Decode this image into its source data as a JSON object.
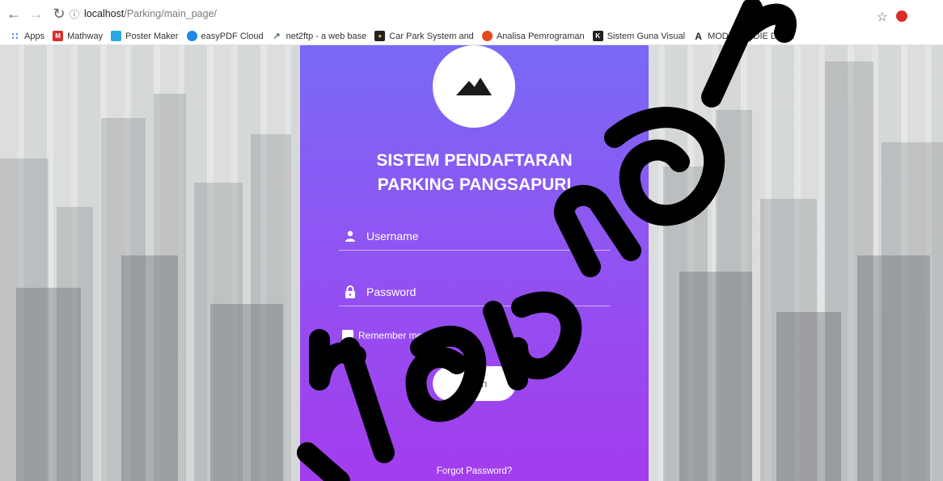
{
  "browser": {
    "url_host": "localhost",
    "url_path": "/Parking/main_page/",
    "bookmarks": [
      {
        "label": "Apps",
        "icon": "apps-grid-icon",
        "color": "#1a73e8"
      },
      {
        "label": "Mathway",
        "icon": "mathway-icon",
        "color": "#d32f2f"
      },
      {
        "label": "Poster Maker",
        "icon": "poster-maker-icon",
        "color": "#29a8e0"
      },
      {
        "label": "easyPDF Cloud",
        "icon": "easypdf-icon",
        "color": "#1e88e5"
      },
      {
        "label": "net2ftp - a web base",
        "icon": "net2ftp-icon",
        "color": "#546e7a"
      },
      {
        "label": "Car Park System and",
        "icon": "car-park-icon",
        "color": "#212121"
      },
      {
        "label": "Analisa Pemrograman",
        "icon": "analisa-icon",
        "color": "#e64a19"
      },
      {
        "label": "Sistem Guna Visual",
        "icon": "sistem-guna-icon",
        "color": "#212121"
      },
      {
        "label": "MODEL ADDIE DALA",
        "icon": "addie-icon",
        "color": "#212121"
      }
    ]
  },
  "login": {
    "title_line1": "SISTEM PENDAFTARAN",
    "title_line2": "PARKING PANGSAPURI",
    "username_placeholder": "Username",
    "password_placeholder": "Password",
    "remember_label": "Remember me",
    "login_label": "Login",
    "forgot_label": "Forgot Password?"
  },
  "colors": {
    "card_top": "#7969f6",
    "card_bottom": "#a33ced"
  }
}
